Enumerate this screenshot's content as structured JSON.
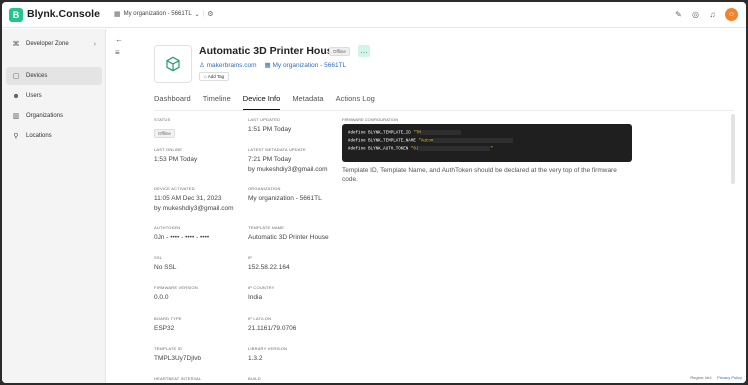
{
  "app": {
    "logo_letter": "B",
    "brand": "Blynk.Console",
    "org_switch": "My organization - 5661TL"
  },
  "sidebar": {
    "items": [
      {
        "label": "Developer Zone",
        "icon": "terminal-icon"
      },
      {
        "label": "Devices",
        "icon": "devices-icon"
      },
      {
        "label": "Users",
        "icon": "users-icon"
      },
      {
        "label": "Organizations",
        "icon": "building-icon"
      },
      {
        "label": "Locations",
        "icon": "pin-icon"
      }
    ]
  },
  "device": {
    "title": "Automatic 3D Printer House",
    "status": "Offline",
    "owner": "makerbrains.com",
    "org": "My organization - 5661TL",
    "add_tag": "Add Tag"
  },
  "tabs": [
    "Dashboard",
    "Timeline",
    "Device Info",
    "Metadata",
    "Actions Log"
  ],
  "info": {
    "status_label": "STATUS",
    "status_value": "Offline",
    "last_updated_label": "LAST UPDATED",
    "last_updated_value": "1:51 PM Today",
    "last_online_label": "LAST ONLINE",
    "last_online_value": "1:53 PM Today",
    "last_meta_label": "LATEST METADATA UPDATE",
    "last_meta_value": "7:21 PM Today",
    "last_meta_by": "by mukeshdiy3@gmail.com",
    "activated_label": "DEVICE ACTIVATED",
    "activated_value": "11:05 AM Dec 31, 2023",
    "activated_by": "by mukeshdiy3@gmail.com",
    "org_label": "ORGANIZATION",
    "org_value": "My organization - 5661TL",
    "authtoken_label": "AUTHTOKEN",
    "authtoken_value": "0Jn - •••• - •••• - ••••",
    "template_name_label": "TEMPLATE NAME",
    "template_name_value": "Automatic 3D Printer House",
    "ssl_label": "SSL",
    "ssl_value": "No SSL",
    "ip_label": "IP",
    "ip_value": "152.58.22.164",
    "fw_version_label": "FIRMWARE VERSION",
    "fw_version_value": "0.0.0",
    "ip_country_label": "IP COUNTRY",
    "ip_country_value": "India",
    "board_label": "BOARD TYPE",
    "board_value": "ESP32",
    "latlon_label": "IP LAT/LON",
    "latlon_value": "21.1161/79.0706",
    "template_id_label": "TEMPLATE ID",
    "template_id_value": "TMPL3Uy7Djlvb",
    "lib_label": "LIBRARY VERSION",
    "lib_value": "1.3.2",
    "heartbeat_label": "HEARTBEAT INTERVAL",
    "build_label": "BUILD"
  },
  "firmware": {
    "label": "FIRMWARE CONFIGURATION",
    "line1_kw": "#define BLYNK_TEMPLATE_ID ",
    "line1_val": "\"TM",
    "line2_kw": "#define BLYNK_TEMPLATE_NAME ",
    "line2_val": "\"Autom",
    "line3_kw": "#define BLYNK_AUTH_TOKEN ",
    "line3_val": "\"0J",
    "line3_end": "\"",
    "note": "Template ID, Template Name, and AuthToken should be declared at the very top of the firmware code."
  },
  "footer": {
    "region": "Region: blr1",
    "privacy": "Privacy Policy"
  }
}
